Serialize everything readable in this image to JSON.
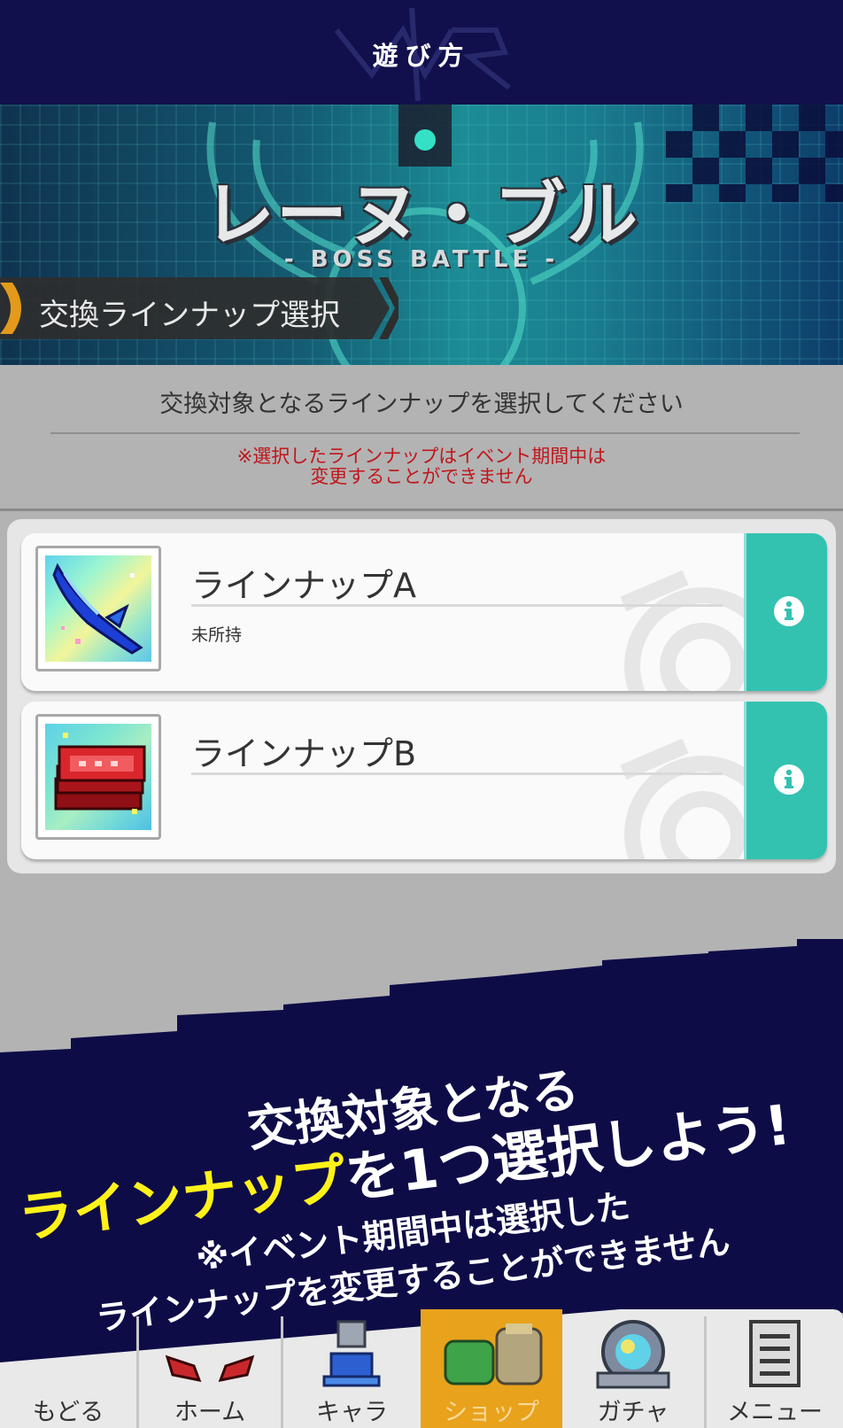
{
  "header": {
    "title": "遊び方",
    "logo_text": "WORLD FLIPPER"
  },
  "banner": {
    "boss_name": "レーヌ・ブル",
    "boss_subtitle": "- BOSS BATTLE -",
    "section_title": "交換ラインナップ選択"
  },
  "instructions": {
    "text": "交換対象となるラインナップを選択してください",
    "warning_line1": "※選択したラインナップはイベント期間中は",
    "warning_line2": "変更することができません"
  },
  "lineups": [
    {
      "name": "ラインナップA",
      "status": "未所持",
      "icon": "blue-feather-blade-icon"
    },
    {
      "name": "ラインナップB",
      "status": "",
      "icon": "red-ticket-stack-icon"
    }
  ],
  "promo": {
    "line1": "交換対象となる",
    "line2_highlight": "ラインナップ",
    "line2_rest": "を1つ選択しよう!",
    "line3": "※イベント期間中は選択した",
    "line4": "ラインナップを変更することができません"
  },
  "nav": {
    "back": "もどる",
    "home": "ホーム",
    "chara": "キャラ",
    "shop": "ショップ",
    "gacha": "ガチャ",
    "menu": "メニュー"
  },
  "colors": {
    "header_bg": "#11104d",
    "info_tab": "#33c2b0",
    "warning_text": "#c0161c",
    "promo_bg": "#0e0c47",
    "promo_highlight": "#fff21a",
    "nav_active": "#e8a21c"
  }
}
